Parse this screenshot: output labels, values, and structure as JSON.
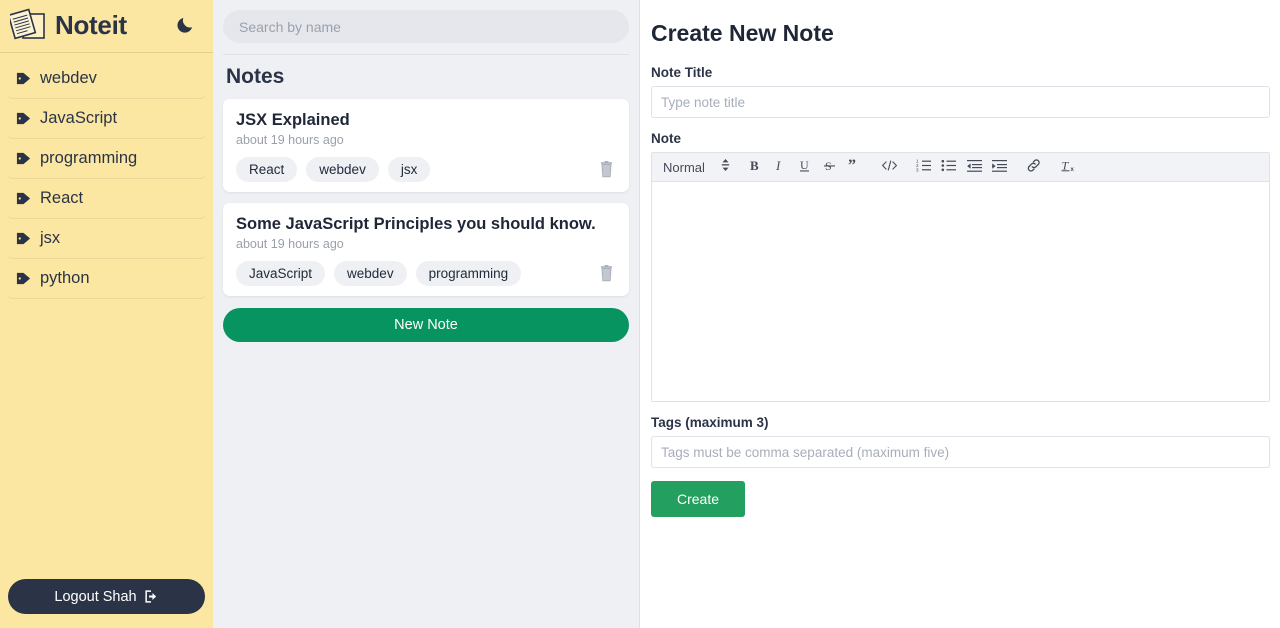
{
  "sidebar": {
    "brand": "Noteit",
    "logo_icon": "notes-stack-icon",
    "theme_toggle_icon": "moon-icon",
    "tags": [
      {
        "label": "webdev",
        "icon": "tag-icon"
      },
      {
        "label": "JavaScript",
        "icon": "tag-icon"
      },
      {
        "label": "programming",
        "icon": "tag-icon"
      },
      {
        "label": "React",
        "icon": "tag-icon"
      },
      {
        "label": "jsx",
        "icon": "tag-icon"
      },
      {
        "label": "python",
        "icon": "tag-icon"
      }
    ],
    "logout_label": "Logout Shah",
    "logout_icon": "logout-icon",
    "bg_color": "#fbe6a2",
    "accent_dark": "#2b3446"
  },
  "notes_panel": {
    "search_placeholder": "Search by name",
    "search_value": "",
    "heading": "Notes",
    "new_note_label": "New Note",
    "new_note_color": "#089460",
    "delete_icon": "trash-icon",
    "notes": [
      {
        "title": "JSX Explained",
        "time": "about 19 hours ago",
        "tags": [
          "React",
          "webdev",
          "jsx"
        ]
      },
      {
        "title": "Some JavaScript Principles you should know.",
        "time": "about 19 hours ago",
        "tags": [
          "JavaScript",
          "webdev",
          "programming"
        ]
      }
    ]
  },
  "editor": {
    "heading": "Create New Note",
    "title_label": "Note Title",
    "title_placeholder": "Type note title",
    "title_value": "",
    "note_label": "Note",
    "body_value": "",
    "tags_label": "Tags (maximum 3)",
    "tags_placeholder": "Tags must be comma separated (maximum five)",
    "tags_value": "",
    "create_label": "Create",
    "create_color": "#23a05f",
    "toolbar": {
      "format_value": "Normal",
      "picker_icon": "chevron-updown-icon",
      "buttons": [
        {
          "name": "bold-icon",
          "glyph": "B"
        },
        {
          "name": "italic-icon",
          "glyph": "I"
        },
        {
          "name": "underline-icon",
          "glyph": "U"
        },
        {
          "name": "strikethrough-icon",
          "glyph": "S"
        },
        {
          "name": "blockquote-icon",
          "glyph": "”"
        },
        {
          "name": "code-block-icon",
          "glyph": "</>"
        },
        {
          "name": "ordered-list-icon",
          "glyph": "ol"
        },
        {
          "name": "bullet-list-icon",
          "glyph": "ul"
        },
        {
          "name": "outdent-icon",
          "glyph": "outdent"
        },
        {
          "name": "indent-icon",
          "glyph": "indent"
        },
        {
          "name": "link-icon",
          "glyph": "link"
        },
        {
          "name": "clear-formatting-icon",
          "glyph": "Tx"
        }
      ]
    }
  }
}
